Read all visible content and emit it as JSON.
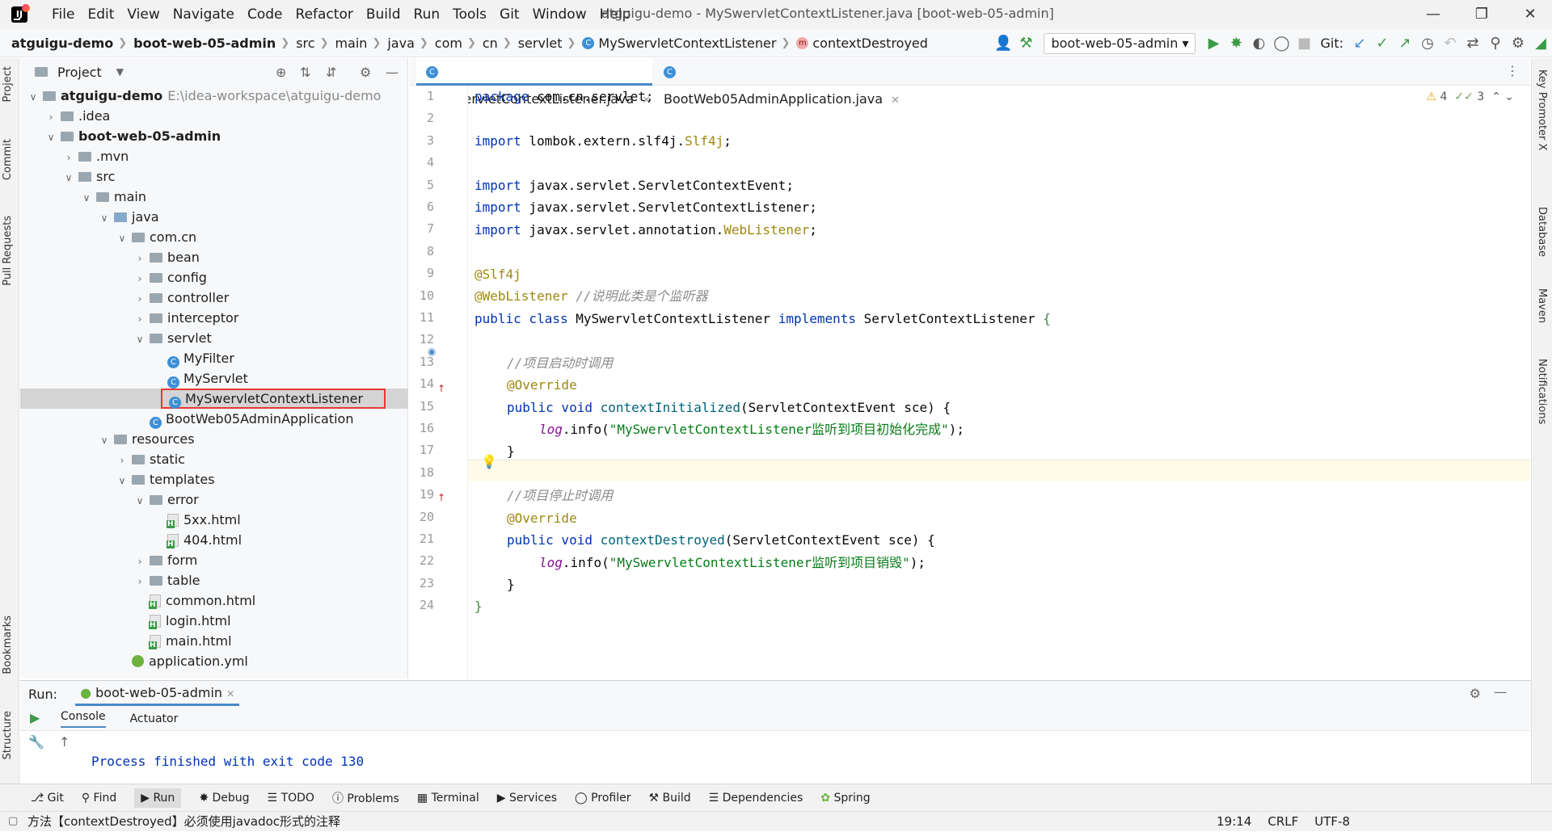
{
  "menu": [
    "File",
    "Edit",
    "View",
    "Navigate",
    "Code",
    "Refactor",
    "Build",
    "Run",
    "Tools",
    "Git",
    "Window",
    "Help"
  ],
  "window_title": "atguigu-demo - MySwervletContextListener.java [boot-web-05-admin]",
  "breadcrumbs": [
    "atguigu-demo",
    "boot-web-05-admin",
    "src",
    "main",
    "java",
    "com",
    "cn",
    "servlet",
    "MySwervletContextListener",
    "contextDestroyed"
  ],
  "run_config": "boot-web-05-admin",
  "git_label": "Git:",
  "left_tabs": [
    "Project",
    "Commit",
    "Pull Requests",
    "Bookmarks",
    "Structure"
  ],
  "right_tabs": [
    "Key Promoter X",
    "Database",
    "Maven",
    "Notifications"
  ],
  "project": {
    "header": "Project",
    "root": "atguigu-demo",
    "root_path": "E:\\idea-workspace\\atguigu-demo",
    "tree": [
      ".idea",
      "boot-web-05-admin",
      ".mvn",
      "src",
      "main",
      "java",
      "com.cn",
      "bean",
      "config",
      "controller",
      "interceptor",
      "servlet",
      "MyFilter",
      "MyServlet",
      "MySwervletContextListener",
      "BootWeb05AdminApplication",
      "resources",
      "static",
      "templates",
      "error",
      "5xx.html",
      "404.html",
      "form",
      "table",
      "common.html",
      "login.html",
      "main.html",
      "application.yml"
    ]
  },
  "editor_tabs": [
    "MySwervletContextListener.java",
    "BootWeb05AdminApplication.java"
  ],
  "inspections": {
    "warnings": "4",
    "weak": "3"
  },
  "code": {
    "l1": [
      "package",
      " com.cn.servlet;"
    ],
    "l3": [
      "import",
      " lombok.extern.slf4j.",
      "Slf4j",
      ";"
    ],
    "l5": [
      "import",
      " javax.servlet.ServletContextEvent;"
    ],
    "l6": [
      "import",
      " javax.servlet.ServletContextListener;"
    ],
    "l7": [
      "import",
      " javax.servlet.annotation.",
      "WebListener",
      ";"
    ],
    "l9": "@Slf4j",
    "l10": [
      "@WebListener",
      " //说明此类是个监听器"
    ],
    "l11": [
      "public class",
      " MySwervletContextListener ",
      "implements",
      " ServletContextListener ",
      "{"
    ],
    "l13": "//项目启动时调用",
    "l14": "@Override",
    "l15": [
      "public void ",
      "contextInitialized",
      "(ServletContextEvent sce) {"
    ],
    "l16": [
      "log",
      ".info(",
      "\"MySwervletContextListener监听到项目初始化完成\"",
      ");"
    ],
    "l17": "}",
    "l19": "//项目停止时调用",
    "l20": "@Override",
    "l21": [
      "public void ",
      "contextDestroyed",
      "(ServletContextEvent sce) {"
    ],
    "l22": [
      "log",
      ".info(",
      "\"MySwervletContextListener监听到项目销毁\"",
      ");"
    ],
    "l23": "}",
    "l24": "}"
  },
  "run": {
    "label": "Run:",
    "tab": "boot-web-05-admin",
    "sub_tabs": [
      "Console",
      "Actuator"
    ],
    "output": "Process finished with exit code 130"
  },
  "bottom_tools": [
    "Git",
    "Find",
    "Run",
    "Debug",
    "TODO",
    "Problems",
    "Terminal",
    "Services",
    "Profiler",
    "Build",
    "Dependencies",
    "Spring"
  ],
  "status": {
    "message": "方法【contextDestroyed】必须使用javadoc形式的注释",
    "position": "19:14",
    "line_sep": "CRLF",
    "encoding": "UTF-8"
  }
}
